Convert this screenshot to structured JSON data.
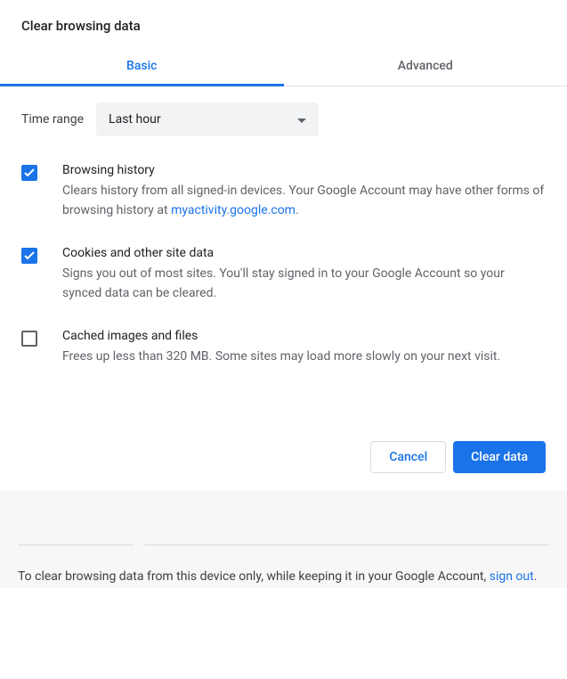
{
  "title": "Clear browsing data",
  "tabs": {
    "basic": "Basic",
    "advanced": "Advanced"
  },
  "timeRange": {
    "label": "Time range",
    "value": "Last hour"
  },
  "options": [
    {
      "checked": true,
      "title": "Browsing history",
      "desc_pre": "Clears history from all signed-in devices. Your Google Account may have other forms of browsing history at ",
      "link": "myactivity.google.com",
      "desc_post": "."
    },
    {
      "checked": true,
      "title": "Cookies and other site data",
      "desc": "Signs you out of most sites. You'll stay signed in to your Google Account so your synced data can be cleared."
    },
    {
      "checked": false,
      "title": "Cached images and files",
      "desc": "Frees up less than 320 MB. Some sites may load more slowly on your next visit."
    }
  ],
  "buttons": {
    "cancel": "Cancel",
    "clear": "Clear data"
  },
  "footer": {
    "pre": "To clear browsing data from this device only, while keeping it in your Google Account, ",
    "link": "sign out",
    "post": "."
  }
}
